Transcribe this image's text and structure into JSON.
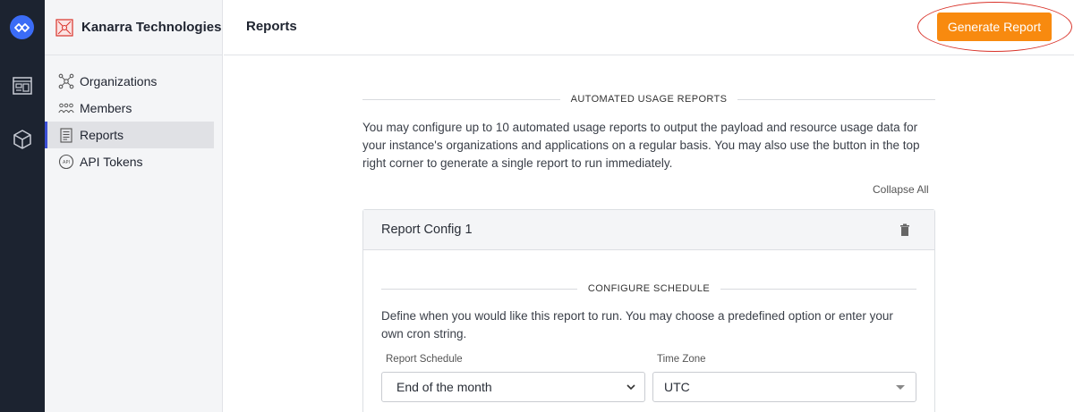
{
  "org": {
    "name": "Kanarra Technologies"
  },
  "sidebar": {
    "items": [
      {
        "label": "Organizations",
        "icon": "organizations-icon"
      },
      {
        "label": "Members",
        "icon": "members-icon"
      },
      {
        "label": "Reports",
        "icon": "reports-icon",
        "active": true
      },
      {
        "label": "API Tokens",
        "icon": "api-tokens-icon"
      }
    ]
  },
  "header": {
    "title": "Reports",
    "generate_button": "Generate Report"
  },
  "main": {
    "section_title": "AUTOMATED USAGE REPORTS",
    "description": "You may configure up to 10 automated usage reports to output the payload and resource usage data for your instance's organizations and applications on a regular basis. You may also use the button in the top right corner to generate a single report to run immediately.",
    "collapse_all": "Collapse All",
    "config": {
      "title": "Report Config 1",
      "schedule_section": "CONFIGURE SCHEDULE",
      "schedule_description": "Define when you would like this report to run. You may choose a predefined option or enter your own cron string.",
      "schedule_label": "Report Schedule",
      "schedule_value": "End of the month",
      "timezone_label": "Time Zone",
      "timezone_value": "UTC"
    }
  },
  "colors": {
    "accent": "#f88a0f",
    "rail_bg": "#1c2330",
    "active_bar": "#3b4fd6",
    "highlight_oval": "#d9332a"
  }
}
